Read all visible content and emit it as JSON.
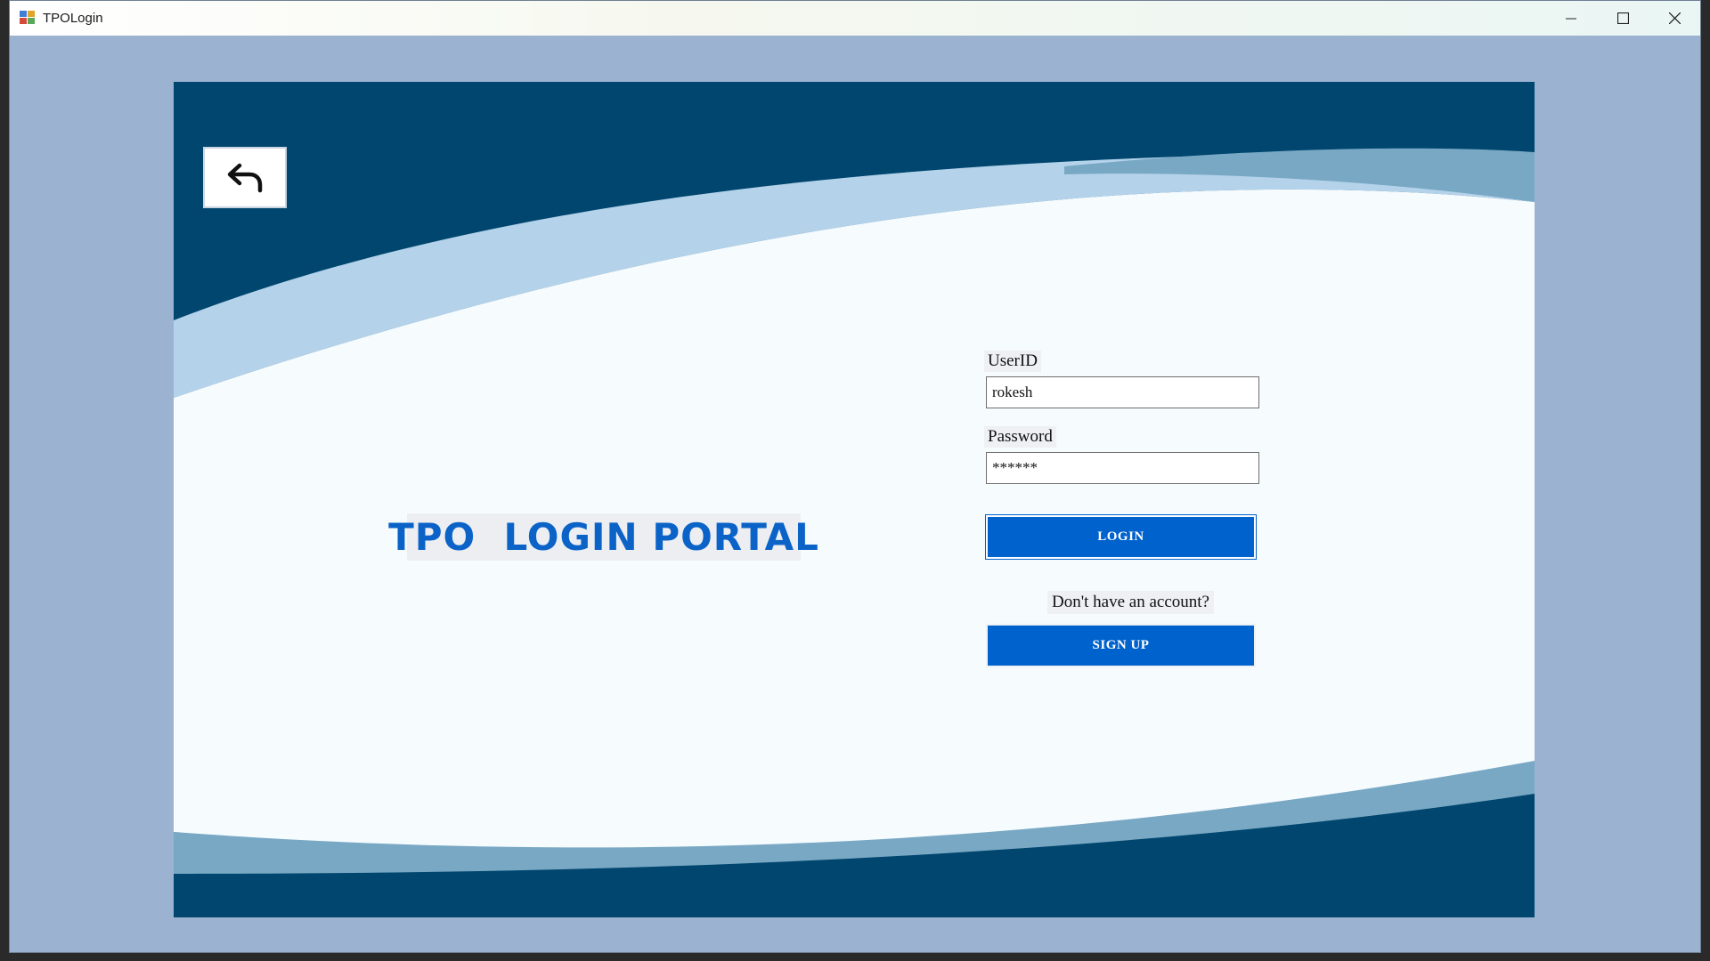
{
  "window": {
    "title": "TPOLogin",
    "controls": {
      "minimize": "minimize-icon",
      "maximize": "maximize-icon",
      "close": "close-icon"
    }
  },
  "colors": {
    "window_background": "#9bb3d1",
    "panel_dark": "#00466e",
    "swoosh_light": "#b4d3ea",
    "swoosh_mid": "#78a8c4",
    "panel_white": "#f6fbfe",
    "brand_blue": "#0062cc",
    "title_blue": "#0b63c8"
  },
  "back_button": {
    "icon": "back-arrow-icon"
  },
  "portal": {
    "title": "TPO  LOGIN PORTAL"
  },
  "form": {
    "userid_label": "UserID",
    "userid_value": "rokesh",
    "password_label": "Password",
    "password_value": "******",
    "login_label": "LOGIN",
    "signup_prompt": "Don't have an account?",
    "signup_label": "SIGN UP"
  }
}
